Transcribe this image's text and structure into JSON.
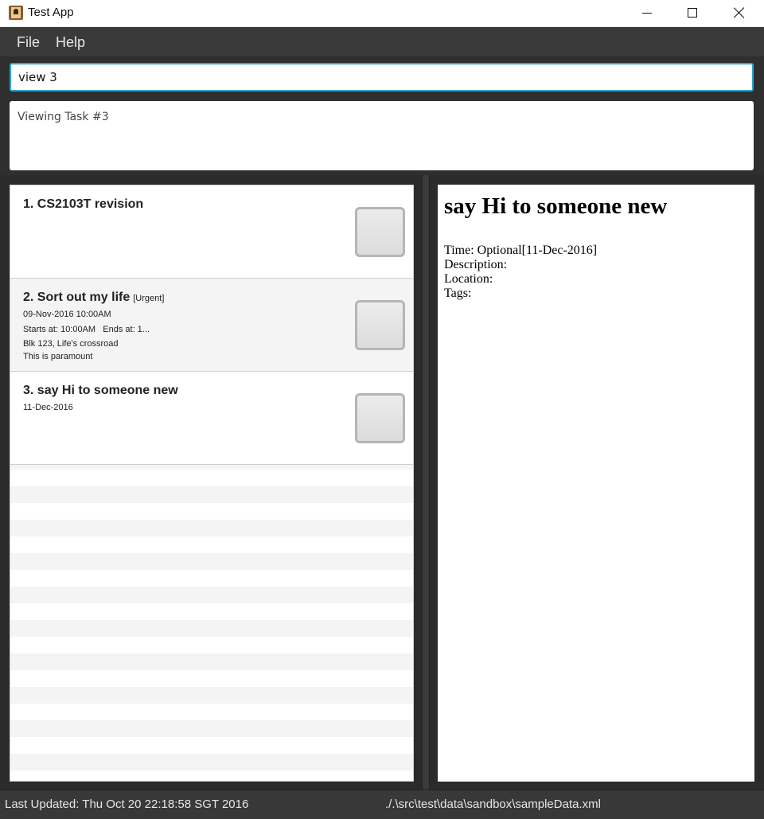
{
  "window": {
    "title": "Test App"
  },
  "menu": {
    "items": [
      "File",
      "Help"
    ]
  },
  "command": {
    "value": "view 3"
  },
  "result": {
    "text": "Viewing Task #3"
  },
  "tasks": [
    {
      "title": "1. CS2103T revision",
      "tag": "",
      "lines": []
    },
    {
      "title": "2. Sort out my life",
      "tag": "[Urgent]",
      "lines": [
        "09-Nov-2016 10:00AM",
        "Starts at: 10:00AM   Ends at: 1...",
        "Blk 123, Life's crossroad",
        "This is paramount"
      ]
    },
    {
      "title": "3. say Hi to someone new",
      "tag": "",
      "lines": [
        "11-Dec-2016"
      ]
    }
  ],
  "detail": {
    "title": "say Hi to someone new",
    "time": "Time: Optional[11-Dec-2016]",
    "description": "Description:",
    "location": "Location:",
    "tags": "Tags:"
  },
  "status": {
    "last_updated": "Last Updated: Thu Oct 20 22:18:58 SGT 2016",
    "file_path": "./.\\src\\test\\data\\sandbox\\sampleData.xml"
  },
  "colors": {
    "accent": "#2ba6c9",
    "dark_bg": "#2b2b2b"
  }
}
